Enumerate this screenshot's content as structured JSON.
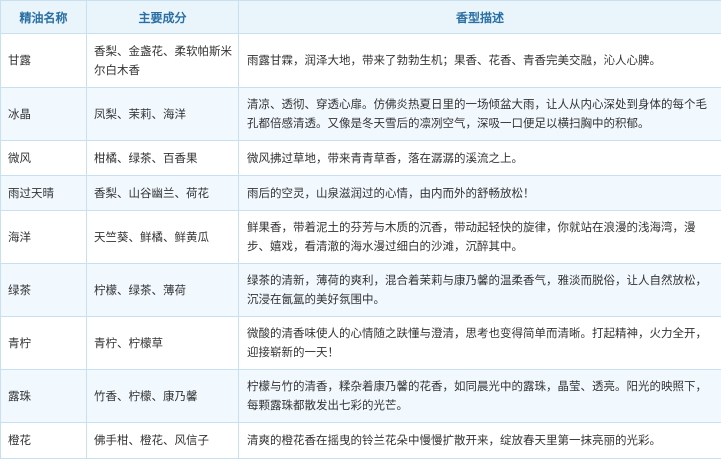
{
  "headers": {
    "name": "精油名称",
    "ingredients": "主要成分",
    "description": "香型描述"
  },
  "rows": [
    {
      "name": "甘露",
      "ingredients": "香梨、金盏花、柔软帕斯米尔白木香",
      "description": "雨露甘霖，润泽大地，带来了勃勃生机；果香、花香、青香完美交融，沁人心脾。"
    },
    {
      "name": "冰晶",
      "ingredients": "凤梨、茉莉、海洋",
      "description": "清凉、透彻、穿透心扉。仿佛炎热夏日里的一场倾盆大雨，让人从内心深处到身体的每个毛孔都倍感清透。又像是冬天雪后的凛冽空气，深吸一口便足以横扫胸中的积郁。"
    },
    {
      "name": "微风",
      "ingredients": "柑橘、绿茶、百香果",
      "description": "微风拂过草地，带来青青草香，落在潺潺的溪流之上。"
    },
    {
      "name": "雨过天晴",
      "ingredients": "香梨、山谷幽兰、荷花",
      "description": "雨后的空灵，山泉滋润过的心情，由内而外的舒畅放松！"
    },
    {
      "name": "海洋",
      "ingredients": "天竺葵、鲜橘、鲜黄瓜",
      "description": "鲜果香，带着泥土的芬芳与木质的沉香，带动起轻快的旋律，你就站在浪漫的浅海湾，漫步、嬉戏，看清澈的海水漫过细白的沙滩，沉醉其中。"
    },
    {
      "name": "绿茶",
      "ingredients": "柠檬、绿茶、薄荷",
      "description": "绿茶的清新，薄荷的爽利，混合着茉莉与康乃馨的温柔香气，雅淡而脱俗，让人自然放松，沉浸在氤氲的美好氛围中。"
    },
    {
      "name": "青柠",
      "ingredients": "青柠、柠檬草",
      "description": "微酸的清香味使人的心情随之趺懂与澄清，思考也变得简单而清晰。打起精神，火力全开，迎接崭新的一天！"
    },
    {
      "name": "露珠",
      "ingredients": "竹香、柠檬、康乃馨",
      "description": "柠檬与竹的清香，糅杂着康乃馨的花香，如同晨光中的露珠，晶莹、透亮。阳光的映照下，每颗露珠都散发出七彩的光芒。"
    },
    {
      "name": "橙花",
      "ingredients": "佛手柑、橙花、风信子",
      "description": "清爽的橙花香在摇曳的铃兰花朵中慢慢扩散开来，绽放春天里第一抹亮丽的光彩。"
    }
  ]
}
